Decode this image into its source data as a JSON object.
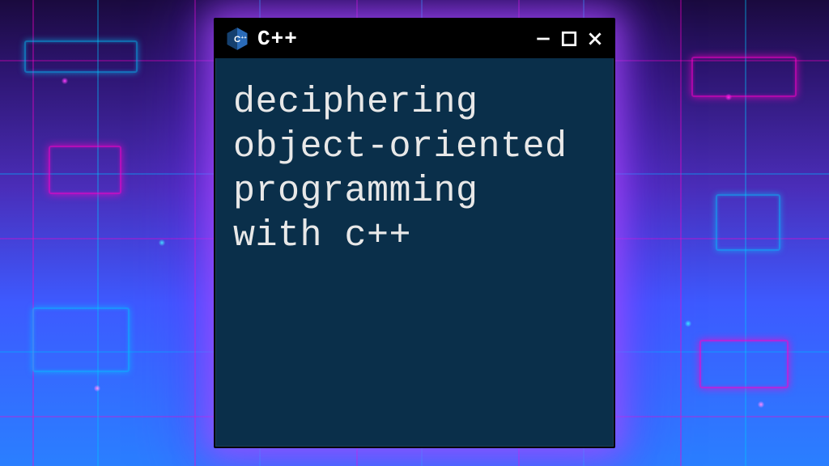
{
  "window": {
    "title": "C++",
    "icon": "cpp-icon",
    "content_lines": [
      "deciphering",
      "object-oriented",
      "programming",
      "with c++"
    ]
  },
  "colors": {
    "window_bg": "#0a2f4a",
    "titlebar_bg": "#000000",
    "text": "#e8e8e8",
    "glow": "#b050ff"
  }
}
